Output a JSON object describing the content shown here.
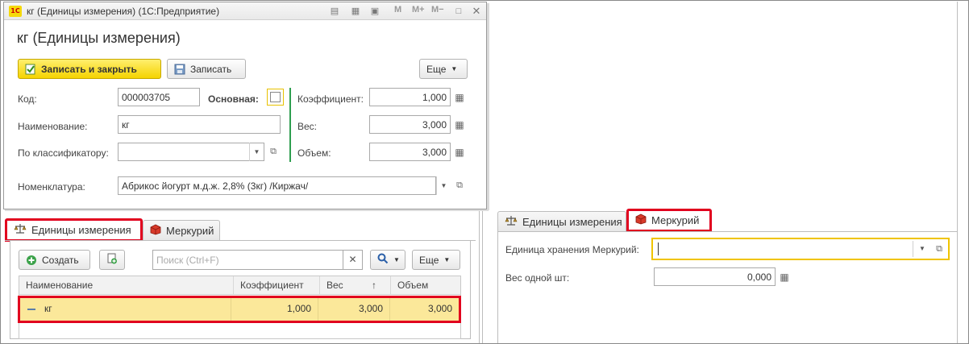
{
  "window": {
    "title": "кг (Единицы измерения)  (1С:Предприятие)",
    "logo_text": "1С",
    "toolbar_m": [
      "M",
      "M+",
      "M−"
    ],
    "form_title": "кг (Единицы измерения)"
  },
  "buttons": {
    "save_close": "Записать и закрыть",
    "save": "Записать",
    "more": "Еще"
  },
  "fields": {
    "code_label": "Код:",
    "code_value": "000003705",
    "main_label": "Основная:",
    "name_label": "Наименование:",
    "name_value": "кг",
    "classifier_label": "По классификатору:",
    "classifier_value": "",
    "coef_label": "Коэффициент:",
    "coef_value": "1,000",
    "weight_label": "Вес:",
    "weight_value": "3,000",
    "volume_label": "Объем:",
    "volume_value": "3,000",
    "nomenclature_label": "Номенклатура:",
    "nomenclature_value": "Абрикос йогурт м.д.ж. 2,8% (3кг) /Киржач/"
  },
  "tabs_left": {
    "units": "Единицы измерения",
    "mercury": "Меркурий"
  },
  "list_toolbar": {
    "create": "Создать",
    "search_placeholder": "Поиск (Ctrl+F)",
    "more": "Еще"
  },
  "table": {
    "headers": [
      "Наименование",
      "Коэффициент",
      "Вес",
      "Объем"
    ],
    "sort_indicator": "↑",
    "rows": [
      {
        "name": "кг",
        "coef": "1,000",
        "weight": "3,000",
        "volume": "3,000"
      }
    ]
  },
  "tabs_right": {
    "units": "Единицы измерения",
    "mercury": "Меркурий"
  },
  "mercury": {
    "storage_unit_label": "Единица хранения Меркурий:",
    "storage_unit_value": "",
    "unit_weight_label": "Вес одной шт:",
    "unit_weight_value": "0,000"
  },
  "colors": {
    "highlight": "#e1001e",
    "accent_yellow": "#f5d300",
    "selected_row": "#fbe89a",
    "separator_green": "#2e9e4f"
  }
}
